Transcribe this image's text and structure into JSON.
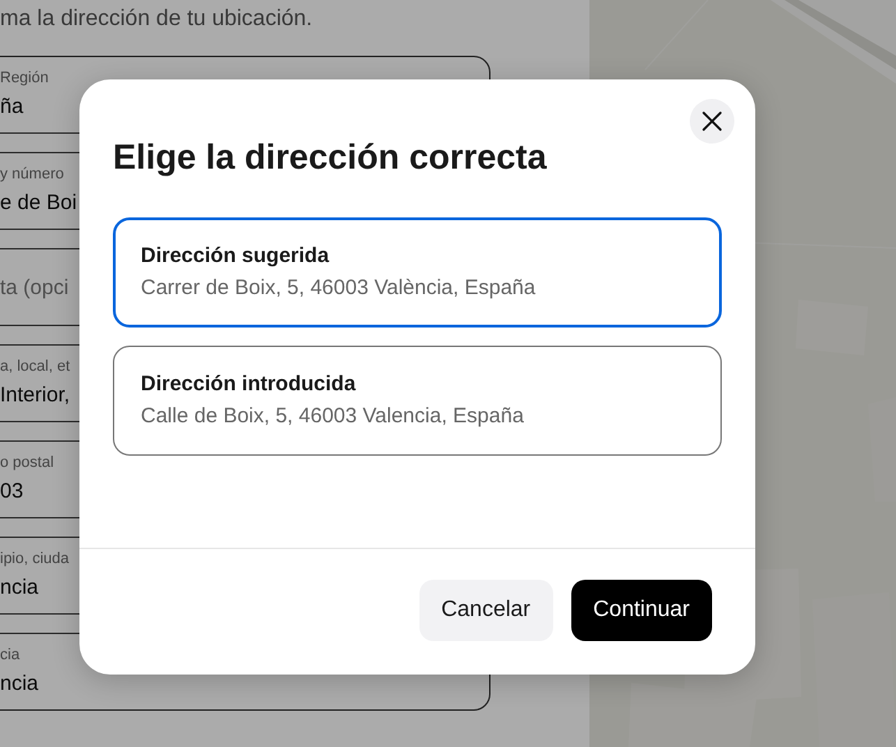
{
  "page": {
    "intro": "ma la dirección de tu ubicación.",
    "fields": [
      {
        "label": "Región",
        "value": "ña"
      },
      {
        "label": "y número",
        "value": "e de Boi"
      },
      {
        "placeholder": "ta (opci"
      },
      {
        "label": "a, local, et",
        "value": "Interior,"
      },
      {
        "label": "o postal",
        "value": "03"
      },
      {
        "label": "ipio, ciuda",
        "value": "ncia"
      },
      {
        "label": "cia",
        "value": "ncia"
      }
    ]
  },
  "dialog": {
    "title": "Elige la dirección correcta",
    "options": [
      {
        "title": "Dirección sugerida",
        "address": "Carrer de Boix, 5, 46003 València, España",
        "selected": true
      },
      {
        "title": "Dirección introducida",
        "address": "Calle de Boix, 5, 46003 Valencia, España",
        "selected": false
      }
    ],
    "buttons": [
      {
        "label": "Cancelar",
        "kind": "secondary"
      },
      {
        "label": "Continuar",
        "kind": "primary"
      }
    ]
  }
}
